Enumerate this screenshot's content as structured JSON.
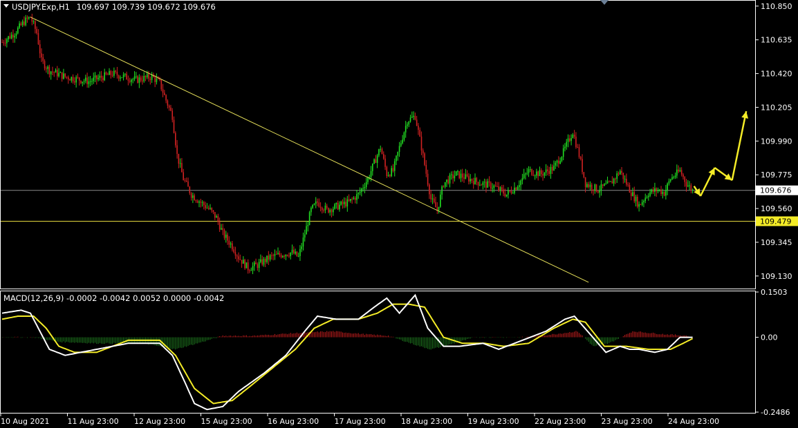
{
  "header": {
    "symbol": "USDJPY.Exp,H1",
    "ohlc": "109.697 109.739 109.672 109.676"
  },
  "chart_data": [
    {
      "type": "candlestick",
      "title": "USDJPY.Exp,H1",
      "ylim": [
        109.05,
        110.88
      ],
      "y_ticks": [
        "110.850",
        "110.635",
        "110.420",
        "110.205",
        "109.990",
        "109.775",
        "109.560",
        "109.345",
        "109.130"
      ],
      "x_ticks": [
        "10 Aug 2021",
        "11 Aug 23:00",
        "12 Aug 23:00",
        "15 Aug 23:00",
        "16 Aug 23:00",
        "17 Aug 23:00",
        "18 Aug 23:00",
        "19 Aug 23:00",
        "22 Aug 23:00",
        "23 Aug 23:00",
        "24 Aug 23:00"
      ],
      "current_price": "109.676",
      "support_level": "109.479",
      "close_path": [
        [
          0,
          110.62
        ],
        [
          8,
          110.68
        ],
        [
          14,
          110.75
        ],
        [
          18,
          110.78
        ],
        [
          22,
          110.68
        ],
        [
          25,
          110.5
        ],
        [
          30,
          110.44
        ],
        [
          40,
          110.4
        ],
        [
          55,
          110.37
        ],
        [
          70,
          110.42
        ],
        [
          85,
          110.38
        ],
        [
          95,
          110.4
        ],
        [
          100,
          110.36
        ],
        [
          104,
          110.25
        ],
        [
          108,
          110.15
        ],
        [
          111,
          109.9
        ],
        [
          115,
          109.75
        ],
        [
          120,
          109.65
        ],
        [
          126,
          109.6
        ],
        [
          132,
          109.55
        ],
        [
          136,
          109.5
        ],
        [
          140,
          109.4
        ],
        [
          146,
          109.32
        ],
        [
          150,
          109.25
        ],
        [
          156,
          109.18
        ],
        [
          162,
          109.2
        ],
        [
          170,
          109.25
        ],
        [
          178,
          109.27
        ],
        [
          184,
          109.28
        ],
        [
          188,
          109.25
        ],
        [
          192,
          109.4
        ],
        [
          196,
          109.55
        ],
        [
          200,
          109.6
        ],
        [
          206,
          109.55
        ],
        [
          214,
          109.58
        ],
        [
          220,
          109.6
        ],
        [
          226,
          109.65
        ],
        [
          232,
          109.75
        ],
        [
          236,
          109.85
        ],
        [
          240,
          109.95
        ],
        [
          244,
          109.78
        ],
        [
          248,
          109.8
        ],
        [
          252,
          109.95
        ],
        [
          257,
          110.12
        ],
        [
          262,
          110.15
        ],
        [
          266,
          109.95
        ],
        [
          272,
          109.62
        ],
        [
          276,
          109.55
        ],
        [
          280,
          109.72
        ],
        [
          288,
          109.78
        ],
        [
          296,
          109.75
        ],
        [
          304,
          109.72
        ],
        [
          312,
          109.7
        ],
        [
          320,
          109.65
        ],
        [
          326,
          109.7
        ],
        [
          334,
          109.8
        ],
        [
          342,
          109.78
        ],
        [
          350,
          109.82
        ],
        [
          356,
          109.92
        ],
        [
          362,
          110.05
        ],
        [
          366,
          109.9
        ],
        [
          370,
          109.72
        ],
        [
          378,
          109.68
        ],
        [
          386,
          109.72
        ],
        [
          392,
          109.8
        ],
        [
          398,
          109.68
        ],
        [
          404,
          109.58
        ],
        [
          410,
          109.66
        ],
        [
          416,
          109.68
        ],
        [
          420,
          109.66
        ],
        [
          424,
          109.75
        ],
        [
          430,
          109.8
        ],
        [
          434,
          109.72
        ],
        [
          438,
          109.676
        ]
      ],
      "trendline": {
        "start": [
          18,
          110.78
        ],
        "end": [
          372,
          109.09
        ]
      },
      "forecast_path": [
        [
          443,
          109.64
        ],
        [
          452,
          109.82
        ],
        [
          463,
          109.74
        ],
        [
          472,
          110.18
        ]
      ]
    },
    {
      "type": "histogram_line",
      "title": "MACD(12,26,9) -0.0002 -0.0042 0.0052 0.0000 -0.0042",
      "ylim": [
        -0.2486,
        0.1503
      ],
      "y_ticks": [
        "0.1503",
        "0.00",
        "-0.2486"
      ],
      "macd_path": [
        [
          0,
          0.08
        ],
        [
          12,
          0.09
        ],
        [
          18,
          0.08
        ],
        [
          24,
          0.02
        ],
        [
          30,
          -0.04
        ],
        [
          40,
          -0.06
        ],
        [
          60,
          -0.04
        ],
        [
          80,
          -0.02
        ],
        [
          100,
          -0.02
        ],
        [
          108,
          -0.06
        ],
        [
          116,
          -0.15
        ],
        [
          122,
          -0.22
        ],
        [
          130,
          -0.24
        ],
        [
          140,
          -0.23
        ],
        [
          150,
          -0.18
        ],
        [
          166,
          -0.12
        ],
        [
          180,
          -0.06
        ],
        [
          192,
          0.02
        ],
        [
          200,
          0.07
        ],
        [
          212,
          0.06
        ],
        [
          226,
          0.06
        ],
        [
          236,
          0.1
        ],
        [
          244,
          0.13
        ],
        [
          252,
          0.08
        ],
        [
          262,
          0.14
        ],
        [
          270,
          0.03
        ],
        [
          280,
          -0.03
        ],
        [
          290,
          -0.03
        ],
        [
          305,
          -0.02
        ],
        [
          315,
          -0.04
        ],
        [
          330,
          -0.01
        ],
        [
          345,
          0.02
        ],
        [
          357,
          0.06
        ],
        [
          363,
          0.07
        ],
        [
          373,
          0.01
        ],
        [
          383,
          -0.05
        ],
        [
          392,
          -0.03
        ],
        [
          398,
          -0.04
        ],
        [
          404,
          -0.04
        ],
        [
          414,
          -0.05
        ],
        [
          422,
          -0.04
        ],
        [
          430,
          0.0
        ],
        [
          438,
          -0.0002
        ]
      ],
      "signal_path": [
        [
          0,
          0.06
        ],
        [
          10,
          0.07
        ],
        [
          20,
          0.07
        ],
        [
          28,
          0.03
        ],
        [
          36,
          -0.03
        ],
        [
          46,
          -0.05
        ],
        [
          60,
          -0.05
        ],
        [
          80,
          -0.01
        ],
        [
          100,
          -0.01
        ],
        [
          110,
          -0.06
        ],
        [
          122,
          -0.17
        ],
        [
          134,
          -0.22
        ],
        [
          146,
          -0.21
        ],
        [
          158,
          -0.16
        ],
        [
          172,
          -0.1
        ],
        [
          186,
          -0.04
        ],
        [
          198,
          0.03
        ],
        [
          210,
          0.06
        ],
        [
          226,
          0.06
        ],
        [
          238,
          0.08
        ],
        [
          248,
          0.11
        ],
        [
          258,
          0.11
        ],
        [
          268,
          0.1
        ],
        [
          280,
          0.0
        ],
        [
          292,
          -0.02
        ],
        [
          306,
          -0.02
        ],
        [
          318,
          -0.03
        ],
        [
          334,
          -0.02
        ],
        [
          350,
          0.03
        ],
        [
          362,
          0.06
        ],
        [
          370,
          0.05
        ],
        [
          382,
          -0.03
        ],
        [
          396,
          -0.03
        ],
        [
          410,
          -0.04
        ],
        [
          424,
          -0.04
        ],
        [
          432,
          -0.02
        ],
        [
          438,
          -0.0042
        ]
      ],
      "histogram_path": [
        [
          0,
          0.0
        ],
        [
          20,
          0.0
        ],
        [
          36,
          -0.015
        ],
        [
          60,
          -0.02
        ],
        [
          90,
          -0.02
        ],
        [
          110,
          -0.04
        ],
        [
          124,
          -0.02
        ],
        [
          140,
          0.005
        ],
        [
          160,
          0.005
        ],
        [
          190,
          0.015
        ],
        [
          210,
          0.02
        ],
        [
          230,
          0.01
        ],
        [
          245,
          0.005
        ],
        [
          265,
          -0.03
        ],
        [
          272,
          -0.04
        ],
        [
          280,
          -0.03
        ],
        [
          300,
          0.0
        ],
        [
          330,
          0.0
        ],
        [
          350,
          0.01
        ],
        [
          365,
          0.02
        ],
        [
          375,
          -0.03
        ],
        [
          385,
          -0.02
        ],
        [
          400,
          0.02
        ],
        [
          420,
          0.01
        ],
        [
          435,
          0.0052
        ]
      ]
    }
  ]
}
